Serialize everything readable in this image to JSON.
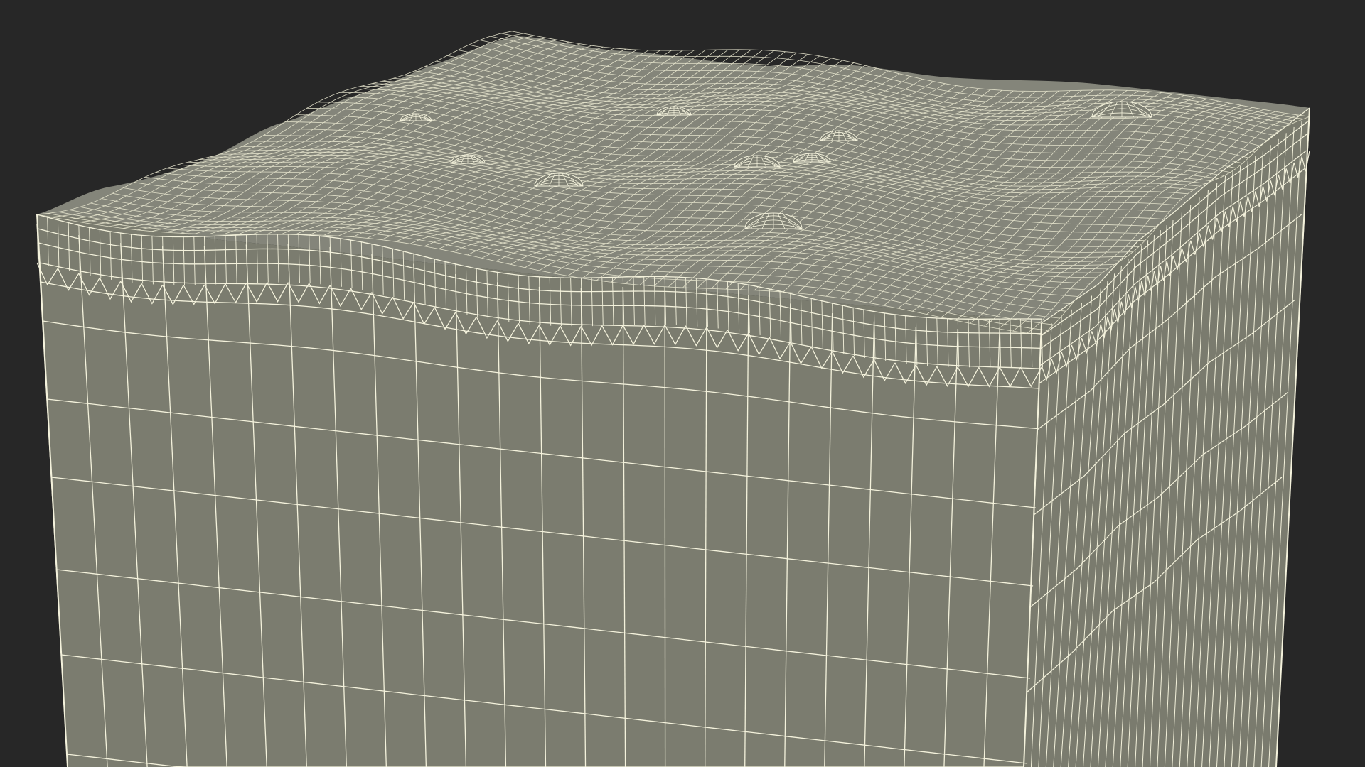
{
  "scene": {
    "subject": "wireframe-skin-block",
    "colors": {
      "background": "#272727",
      "front_face": "#7b7c6f",
      "side_face": "#7a7b6e",
      "top_surface": "#84857a",
      "wire": "#f4f2dc",
      "wire_dense": "#ecead2"
    },
    "bump_count": 9
  }
}
